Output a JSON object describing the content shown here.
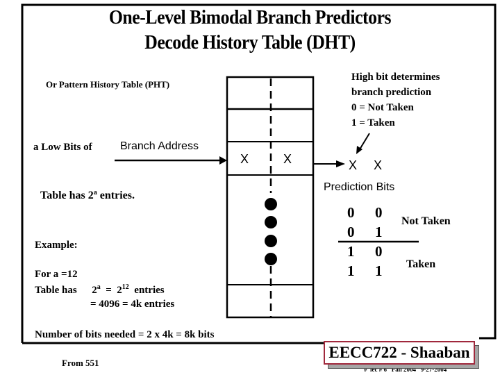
{
  "slide": {
    "title_line1": "One-Level Bimodal Branch Predictors",
    "title_line2": "Decode History Table (DHT)",
    "subtitle_pht": "Or Pattern History Table (PHT)",
    "index_label_prefix": "a  Low Bits of",
    "index_label_address": "Branch Address",
    "table_entries": {
      "prefix": "Table has 2",
      "sup": "a",
      "suffix": " entries."
    },
    "cell_bits": [
      "X",
      "X"
    ],
    "prediction_bits": {
      "values": [
        "X",
        "X"
      ],
      "label": "Prediction Bits"
    },
    "high_bit_note": [
      "High bit determines",
      "branch prediction",
      "0  =  Not Taken",
      "1 =  Taken"
    ],
    "state_table": {
      "rows": [
        [
          "0",
          "0"
        ],
        [
          "0",
          "1"
        ],
        [
          "1",
          "0"
        ],
        [
          "1",
          "1"
        ]
      ],
      "not_taken_label": "Not Taken",
      "taken_label": "Taken"
    },
    "example": {
      "heading": "Example:",
      "line1": "For  a =12",
      "line2_prefix": "Table  has",
      "line2_base1": "2",
      "line2_sup1": "a",
      "line2_eq": "=",
      "line2_base2": "2",
      "line2_sup2": "12",
      "line2_suffix": "entries",
      "line3": "=  4096 =  4k entries"
    },
    "bits_needed": "Number of bits needed =  2 x 4k = 8k bits",
    "source_note": "From 551",
    "badge": "EECC722 - Shaaban",
    "footer": "#  lec # 6   Fall 2004   9-27-2004"
  }
}
